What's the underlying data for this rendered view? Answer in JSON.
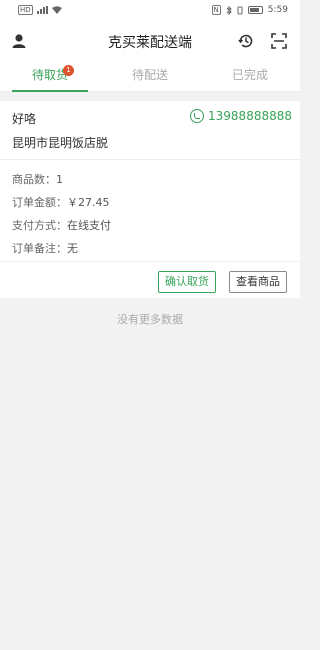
{
  "status_bar": {
    "sim_label": "HD",
    "right_label": "N",
    "time": "5:59"
  },
  "header": {
    "title": "克买莱配送端",
    "icons": [
      "user-icon",
      "history-icon",
      "scan-icon"
    ]
  },
  "tabs": [
    {
      "label": "待取货",
      "badge": "1",
      "active": true
    },
    {
      "label": "待配送",
      "active": false
    },
    {
      "label": "已完成",
      "active": false
    }
  ],
  "order": {
    "customer_name": "好咯",
    "phone": "13988888888",
    "address": "昆明市昆明饭店脱",
    "item_count_label": "商品数：",
    "item_count": "1",
    "amount_label": "订单金额：",
    "amount": "￥27.45",
    "payment_label": "支付方式：",
    "payment": "在线支付",
    "remark_label": "订单备注：",
    "remark": "无",
    "confirm_label": "确认取货",
    "view_label": "查看商品"
  },
  "empty_text": "没有更多数据",
  "colors": {
    "accent": "#3aa35a",
    "badge": "#e0522d",
    "background": "#f2f2f2"
  }
}
